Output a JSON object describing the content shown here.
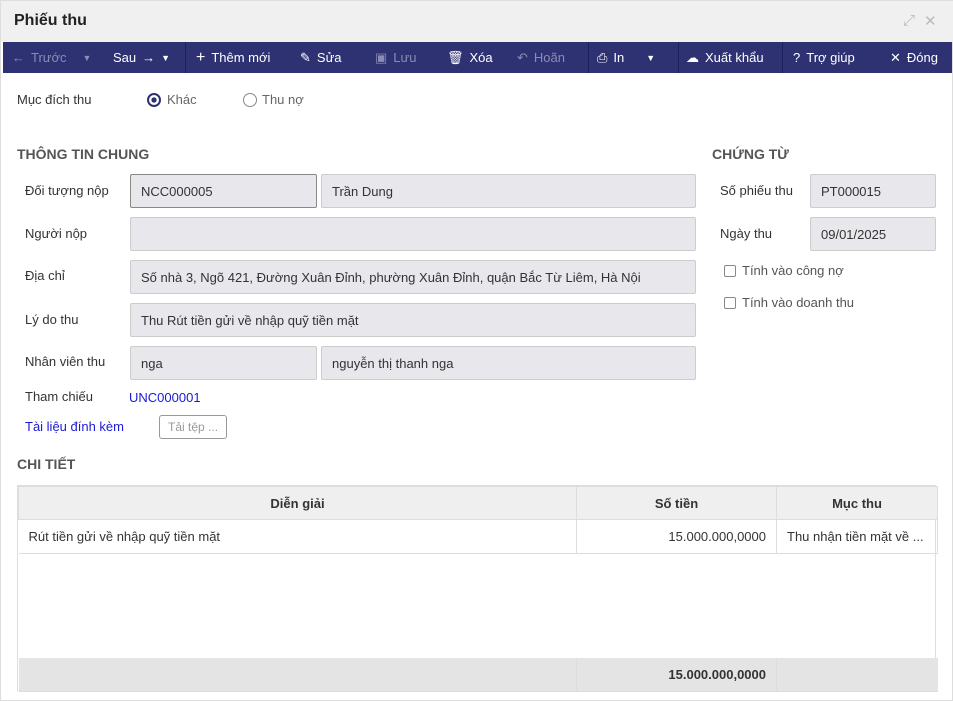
{
  "window": {
    "title": "Phiếu thu"
  },
  "toolbar": {
    "prev": "Trước",
    "next": "Sau",
    "add": "Thêm mới",
    "edit": "Sửa",
    "save": "Lưu",
    "delete": "Xóa",
    "undo": "Hoãn",
    "print": "In",
    "export": "Xuất khẩu",
    "help": "Trợ giúp",
    "close": "Đóng"
  },
  "purpose": {
    "label": "Mục đích thu",
    "options": [
      "Khác",
      "Thu nợ"
    ],
    "selected": "Khác"
  },
  "general": {
    "heading": "THÔNG TIN CHUNG",
    "payer_label": "Đối tượng nộp",
    "payer_code": "NCC000005",
    "payer_name": "Trần Dung",
    "submitter_label": "Người nộp",
    "submitter": "",
    "address_label": "Địa chỉ",
    "address": "Số nhà 3, Ngõ 421, Đường Xuân Đỉnh, phường Xuân Đỉnh, quận Bắc Từ Liêm, Hà Nội",
    "reason_label": "Lý do thu",
    "reason": "Thu Rút tiền gửi về nhập quỹ tiền mặt",
    "staff_label": "Nhân viên thu",
    "staff_code": "nga",
    "staff_name": "nguyễn thị thanh nga",
    "ref_label": "Tham chiếu",
    "ref": "UNC000001",
    "attach_label": "Tài liệu đính kèm",
    "upload": "Tải tệp ..."
  },
  "voucher": {
    "heading": "CHỨNG TỪ",
    "number_label": "Số phiếu thu",
    "number": "PT000015",
    "date_label": "Ngày thu",
    "date": "09/01/2025",
    "debt_label": "Tính vào công nợ",
    "revenue_label": "Tính vào doanh thu"
  },
  "detail": {
    "heading": "CHI TIẾT",
    "columns": [
      "Diễn giải",
      "Số tiền",
      "Mục thu"
    ],
    "rows": [
      {
        "desc": "Rút tiền gửi về nhập quỹ tiền mặt",
        "amount": "15.000.000,0000",
        "category": "Thu nhận tiền mặt về ..."
      }
    ],
    "total": "15.000.000,0000"
  }
}
